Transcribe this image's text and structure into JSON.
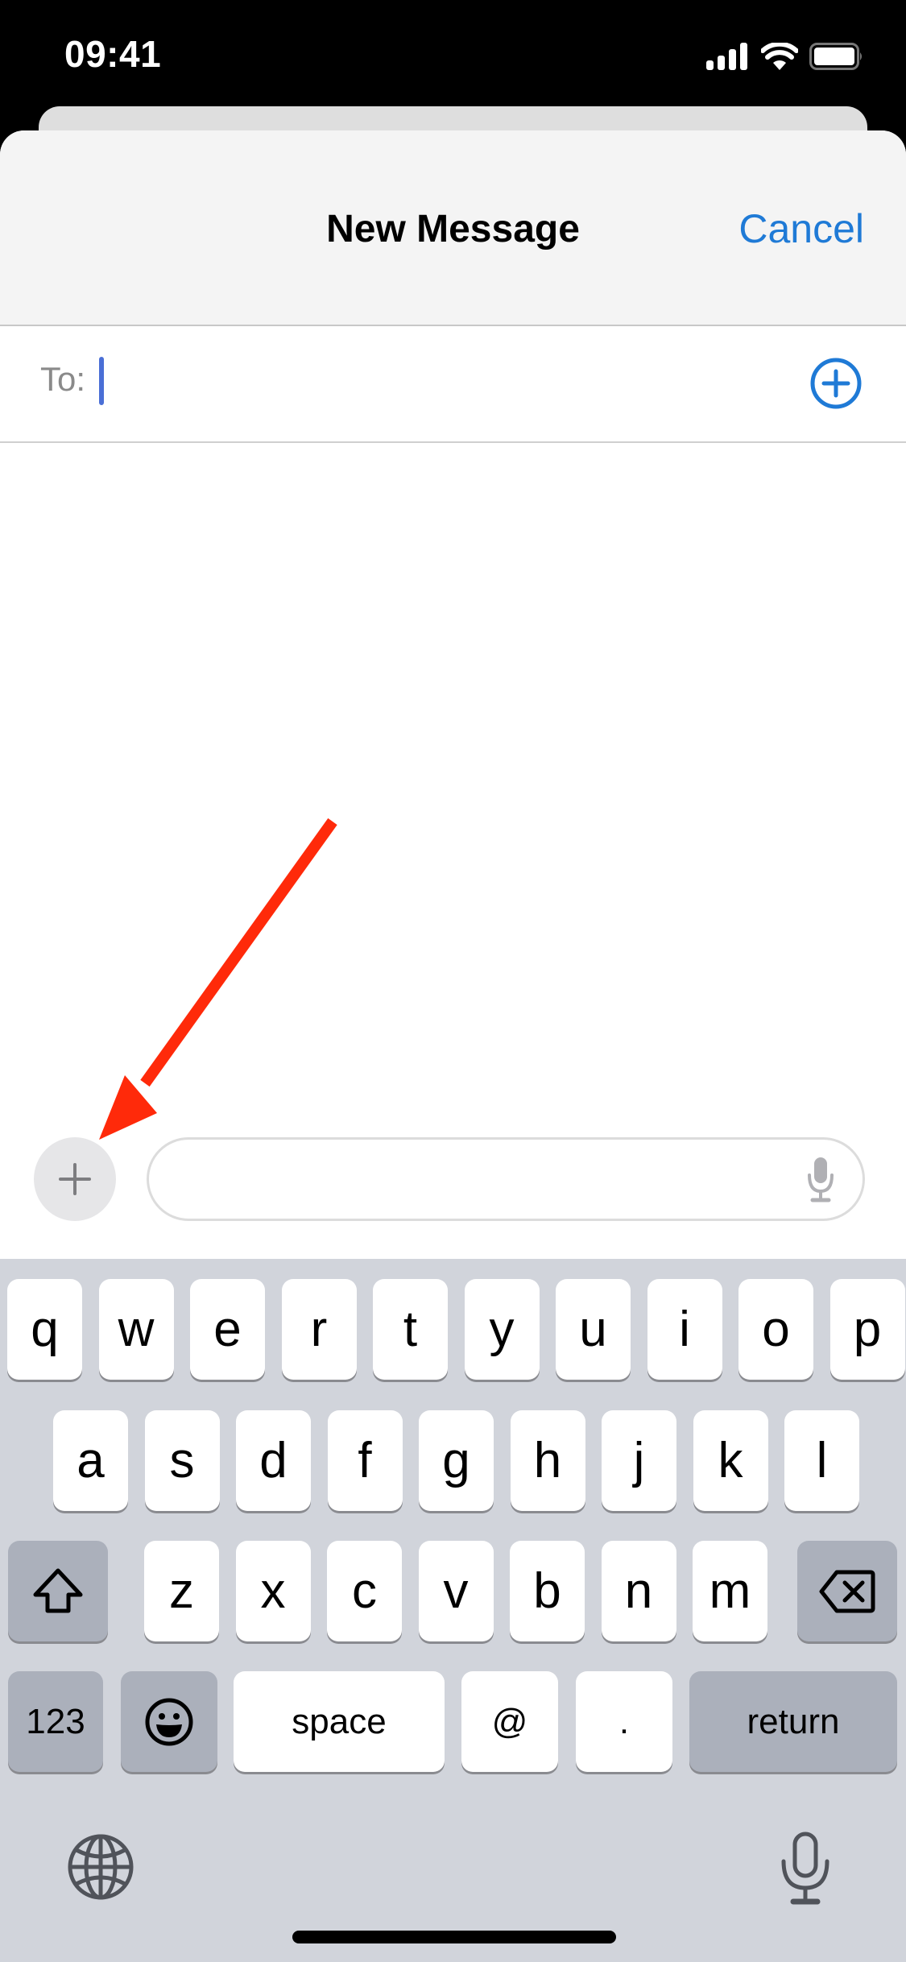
{
  "status_bar": {
    "time": "09:41",
    "icons": [
      "cellular-signal-icon",
      "wifi-icon",
      "battery-icon"
    ]
  },
  "header": {
    "title": "New Message",
    "cancel_label": "Cancel"
  },
  "recipient": {
    "label": "To:",
    "value": "",
    "add_icon": "plus-circle-icon"
  },
  "compose": {
    "attach_icon": "plus-icon",
    "message_value": "",
    "dictation_icon": "microphone-icon"
  },
  "annotation": {
    "type": "arrow",
    "color": "#ff2a0a",
    "points_to": "attach-button"
  },
  "keyboard": {
    "row1": [
      "q",
      "w",
      "e",
      "r",
      "t",
      "y",
      "u",
      "i",
      "o",
      "p"
    ],
    "row2": [
      "a",
      "s",
      "d",
      "f",
      "g",
      "h",
      "j",
      "k",
      "l"
    ],
    "row3": [
      "z",
      "x",
      "c",
      "v",
      "b",
      "n",
      "m"
    ],
    "shift_icon": "shift-icon",
    "delete_icon": "backspace-icon",
    "numbers_label": "123",
    "emoji_icon": "emoji-icon",
    "space_label": "space",
    "at_label": "@",
    "period_label": ".",
    "return_label": "return",
    "globe_icon": "globe-icon",
    "dictation_icon": "microphone-icon"
  },
  "colors": {
    "accent": "#1f7ad6",
    "caret": "#4a6fd6",
    "keyboard_bg": "#d1d4db",
    "special_key": "#abb0bb",
    "annotation": "#ff2a0a"
  }
}
